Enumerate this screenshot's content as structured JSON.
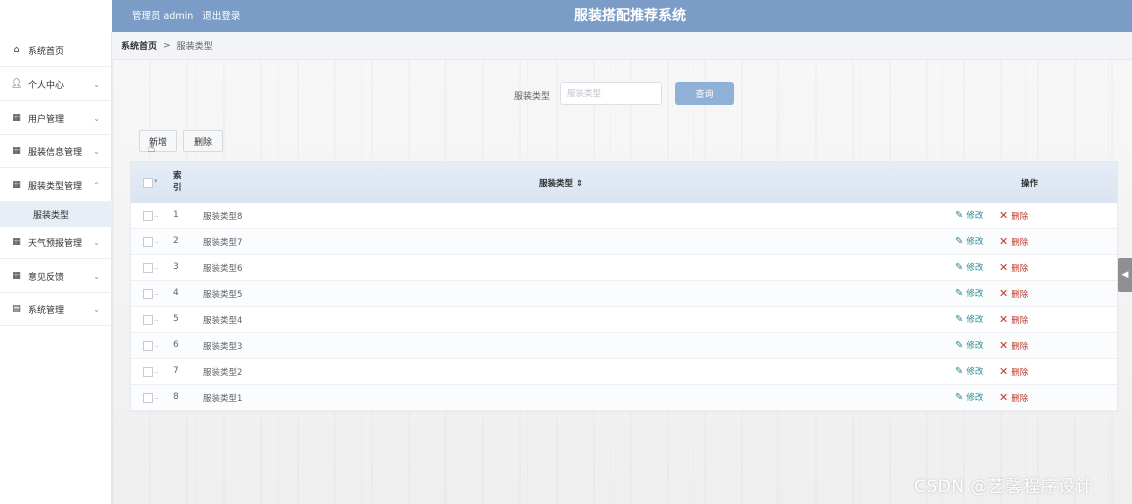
{
  "header": {
    "admin_label": "管理员 admin",
    "logout": "退出登录",
    "title": "服装搭配推荐系统"
  },
  "sidebar": {
    "items": [
      {
        "icon": "home-icon",
        "glyph": "▲",
        "label": "系统首页",
        "arrow": ""
      },
      {
        "icon": "user-icon",
        "glyph": "●",
        "label": "个人中心",
        "arrow": "⌄"
      },
      {
        "icon": "grid-icon",
        "glyph": "■",
        "label": "用户管理",
        "arrow": "⌄"
      },
      {
        "icon": "grid-icon",
        "glyph": "■",
        "label": "服装信息管理",
        "arrow": "⌄"
      },
      {
        "icon": "grid-icon",
        "glyph": "■",
        "label": "服装类型管理",
        "arrow": "⌃"
      },
      {
        "icon": "grid-icon",
        "glyph": "■",
        "label": "天气预报管理",
        "arrow": "⌄"
      },
      {
        "icon": "grid-icon",
        "glyph": "■",
        "label": "意见反馈",
        "arrow": "⌄"
      },
      {
        "icon": "document-icon",
        "glyph": "▤",
        "label": "系统管理",
        "arrow": "⌄"
      }
    ],
    "submenu_active": "服装类型"
  },
  "breadcrumb": {
    "home": "系统首页",
    "sep": ">",
    "current": "服装类型"
  },
  "search": {
    "label": "服装类型",
    "placeholder": "服装类型",
    "button": "查询"
  },
  "actions": {
    "add": "新增",
    "delete": "删除"
  },
  "table": {
    "headers": {
      "index": "索引",
      "type": "服装类型 ⇕",
      "ops": "操作"
    },
    "rows": [
      {
        "idx": "1",
        "name": "服装类型8"
      },
      {
        "idx": "2",
        "name": "服装类型7"
      },
      {
        "idx": "3",
        "name": "服装类型6"
      },
      {
        "idx": "4",
        "name": "服装类型5"
      },
      {
        "idx": "5",
        "name": "服装类型4"
      },
      {
        "idx": "6",
        "name": "服装类型3"
      },
      {
        "idx": "7",
        "name": "服装类型2"
      },
      {
        "idx": "8",
        "name": "服装类型1"
      }
    ],
    "edit_label": "修改",
    "delete_label": "删除"
  },
  "side_tab": "◀",
  "watermark": "CSDN @艺馨程序设计",
  "colors": {
    "header": "#7a9cc6",
    "query_button": "#8fb1d8",
    "edit": "#2f8a8f",
    "delete": "#c0392b"
  }
}
